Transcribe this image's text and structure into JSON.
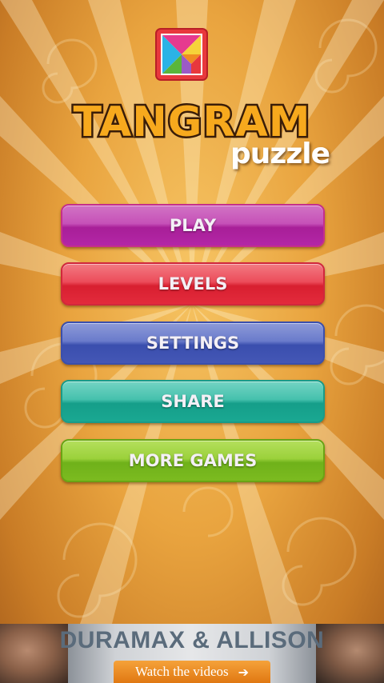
{
  "app": {
    "title": "TANGRAM",
    "subtitle": "puzzle"
  },
  "menu": {
    "play": "PLAY",
    "levels": "LEVELS",
    "settings": "SETTINGS",
    "share": "SHARE",
    "more_games": "MORE GAMES"
  },
  "ad": {
    "headline": "DURAMAX & ALLISON",
    "cta": "Watch the videos",
    "cta_icon": "arrow-right-icon"
  },
  "colors": {
    "background": "#e9a43f",
    "play": "#c651b8",
    "levels": "#ec4c5a",
    "settings": "#6a7bcb",
    "share": "#45c1ad",
    "more_games": "#9bd13b",
    "ad_cta": "#f08c22"
  }
}
